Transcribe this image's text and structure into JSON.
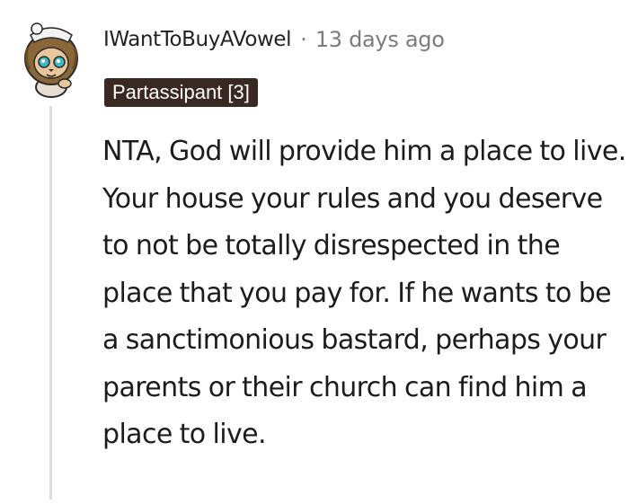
{
  "comment": {
    "username": "IWantToBuyAVowel",
    "separator": "·",
    "timestamp": "13 days ago",
    "flair": "Partassipant [3]",
    "body": "NTA, God will provide him a place to live. Your house your rules and you deserve to not be totally disrespected in the place that you pay for. If he wants to be a sanctimonious bastard, perhaps your parents or their church can find him a place to live.",
    "avatar_icon": "snoo-avatar-icon",
    "colors": {
      "flair_background": "#3a2822",
      "flair_text": "#ffffff",
      "username": "#222222",
      "timestamp": "#7c7c7c",
      "body_text": "#1c1c1c",
      "thread_line": "#dcdcdc"
    }
  }
}
